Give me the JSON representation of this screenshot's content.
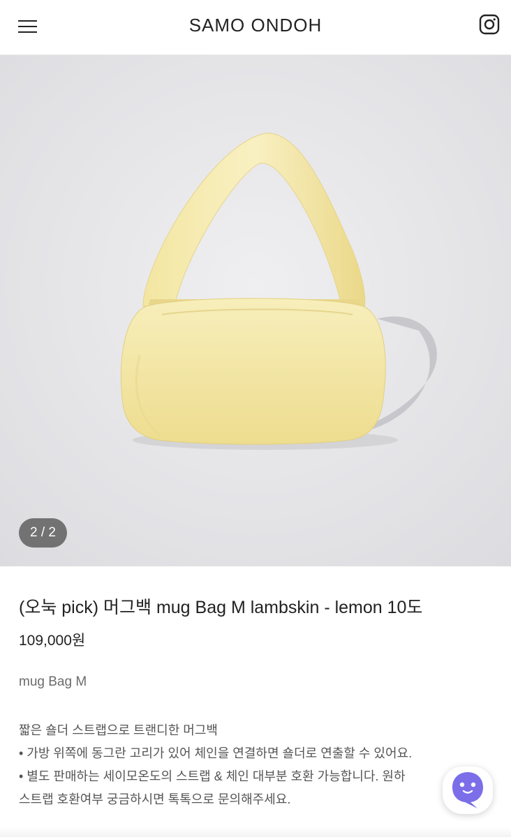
{
  "header": {
    "brand": "SAMO ONDOH",
    "icons": {
      "menu": "hamburger-menu-icon",
      "social": "instagram-icon"
    }
  },
  "gallery": {
    "counter": "2 / 2",
    "image_subject": "yellow puffy lambskin shoulder bag on light grey background",
    "colors": {
      "background": "#e6e6e8",
      "bag": "#f4e7a6"
    }
  },
  "product": {
    "title": "(오눅 pick) 머그백 mug Bag M lambskin - lemon 10도",
    "price": "109,000원",
    "subtitle": "mug Bag M",
    "description": [
      "짧은 숄더 스트랩으로 트랜디한 머그백",
      "• 가방 위쪽에 동그란 고리가 있어 체인을 연결하면 숄더로 연출할 수 있어요.",
      "• 별도 판매하는 세이모온도의 스트랩 & 체인 대부분 호환 가능합니다. 원하",
      "스트랩 호환여부 궁금하시면 톡톡으로 문의해주세요."
    ]
  },
  "chat": {
    "icon": "chat-bot-icon",
    "accent": "#7b6ee8"
  }
}
